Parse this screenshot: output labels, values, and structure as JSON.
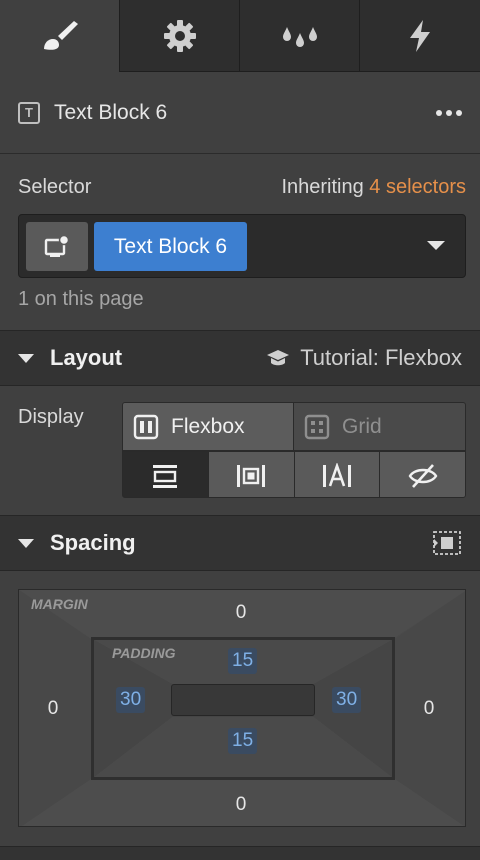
{
  "tabs": [
    {
      "name": "style",
      "icon": "paintbrush-icon"
    },
    {
      "name": "settings",
      "icon": "gear-icon"
    },
    {
      "name": "interactions",
      "icon": "drops-icon"
    },
    {
      "name": "lightning",
      "icon": "lightning-icon"
    }
  ],
  "element": {
    "type_icon": "T",
    "name": "Text Block 6"
  },
  "selector": {
    "label": "Selector",
    "inheriting_prefix": "Inheriting ",
    "inheriting_count": "4 selectors",
    "class_name": "Text Block 6",
    "on_page": "1 on this page"
  },
  "layout": {
    "title": "Layout",
    "tutorial": "Tutorial: Flexbox",
    "display_label": "Display",
    "options": [
      "Flexbox",
      "Grid"
    ],
    "selected": "block"
  },
  "spacing": {
    "title": "Spacing",
    "margin_label": "MARGIN",
    "padding_label": "PADDING",
    "margin": {
      "top": "0",
      "right": "0",
      "bottom": "0",
      "left": "0"
    },
    "padding": {
      "top": "15",
      "right": "30",
      "bottom": "15",
      "left": "30"
    }
  },
  "colors": {
    "accent_blue": "#3d7fd0",
    "accent_orange": "#e6904a",
    "panel": "#404040"
  }
}
